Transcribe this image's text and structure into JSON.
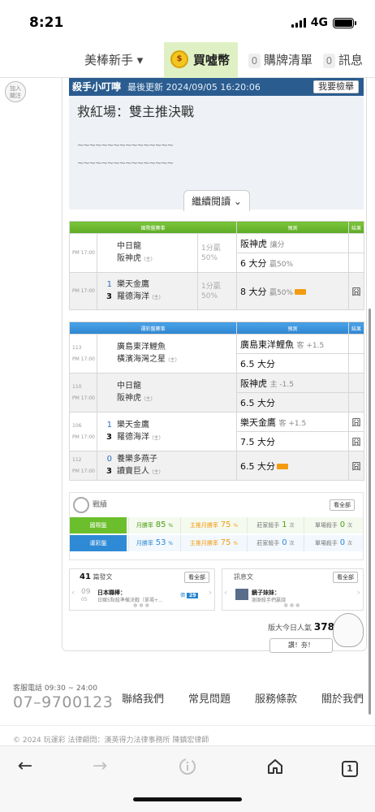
{
  "status": {
    "time": "8:21",
    "network": "4G"
  },
  "nav": {
    "member": "美棒新手 ▾",
    "buy": "買噓幣",
    "cart_count": "0",
    "cart": "購牌清單",
    "msg_count": "0",
    "msg": "訊息"
  },
  "join": "加入\n關注",
  "tips": {
    "title": "殺手小叮嚀",
    "updated": "最後更新 2024/09/05 16:20:06",
    "report": "我要檢舉",
    "headline": "救紅場：雙主推決戰",
    "line1": "~~~~~~~~~~~~~~~~",
    "line2": "~~~~~~~~~~~~~~~~",
    "more": "繼續閱讀 ⌄"
  },
  "intl": {
    "header_event": "國際盤賽事",
    "header_pred": "預測",
    "header_result": "結果",
    "rows": [
      {
        "time": "PM 17:00",
        "home_num": "",
        "home": "中日龍",
        "away_num": "",
        "away": "阪神虎",
        "away_flag": "(主)",
        "odds": "1分贏\n50%",
        "pred1": "阪神虎",
        "pred1_sub": "讓分",
        "pred2": "6 大分",
        "pred2_sub": "贏50%",
        "hot2": false,
        "result1": "",
        "result2": ""
      },
      {
        "time": "PM 17:00",
        "home_num": "1",
        "home": "樂天金鷹",
        "away_num": "3",
        "away": "羅德海洋",
        "away_flag": "(主)",
        "odds": "1分贏\n50%",
        "pred1": "8 大分",
        "pred1_sub": "贏50%",
        "hot1": true,
        "result1": "囧"
      }
    ]
  },
  "sport": {
    "header_event": "運彩盤賽事",
    "header_pred": "預測",
    "header_result": "結果",
    "rows": [
      {
        "code": "113",
        "time": "PM 17:00",
        "home_num": "",
        "home": "廣島東洋鯉魚",
        "away_num": "",
        "away": "橫濱海灣之星",
        "away_flag": "(主)",
        "pred1": "廣島東洋鯉魚",
        "pred1_sub": "客 +1.5",
        "pred2": "6.5 大分",
        "result1": "",
        "result2": ""
      },
      {
        "code": "110",
        "time": "PM 17:00",
        "home_num": "",
        "home": "中日龍",
        "away_num": "",
        "away": "阪神虎",
        "away_flag": "(主)",
        "pred1": "阪神虎",
        "pred1_sub": "主 -1.5",
        "pred2": "6.5 大分",
        "result1": "",
        "result2": ""
      },
      {
        "code": "106",
        "time": "PM 17:00",
        "home_num": "1",
        "home": "樂天金鷹",
        "away_num": "3",
        "away": "羅德海洋",
        "away_flag": "(主)",
        "pred1": "樂天金鷹",
        "pred1_sub": "客 +1.5",
        "pred2": "7.5 大分",
        "result1": "囧",
        "result2": "囧"
      },
      {
        "code": "112",
        "time": "PM 17:00",
        "home_num": "0",
        "home": "養樂多燕子",
        "away_num": "3",
        "away": "讀賣巨人",
        "away_flag": "(主)",
        "pred1": "6.5 大分",
        "hot1": true,
        "result1": "囧"
      }
    ]
  },
  "stats": {
    "title": "戰績",
    "see_all": "看全部",
    "intl": {
      "label": "國際盤",
      "month_rate": "月勝率",
      "month_val": "85",
      "main_rate": "主推月勝率",
      "main_val": "75",
      "banker": "莊家殺手",
      "banker_val": "1",
      "single": "單場殺手",
      "single_val": "0",
      "unit_pct": "%",
      "unit_times": "次"
    },
    "sport": {
      "label": "運彩盤",
      "month_rate": "月勝率",
      "month_val": "53",
      "main_rate": "主推月勝率",
      "main_val": "75",
      "banker": "莊家殺手",
      "banker_val": "0",
      "single": "單場殺手",
      "single_val": "0",
      "unit_pct": "%",
      "unit_times": "次"
    },
    "colors": {
      "intl": "#6cbf2c",
      "sport": "#2f8ad6",
      "main": "#f39c12"
    }
  },
  "posts": {
    "count": "41",
    "count_label": "篇發文",
    "see_all": "看全部",
    "date_m": "09",
    "date_d": "05",
    "title": "日本職棒：",
    "excerpt": "日職5點殺準備決戰（單場+…",
    "price_label": "價",
    "price": "29"
  },
  "followers": {
    "title": "訊息文",
    "see_all": "看全部",
    "name": "鏡子妹妹：",
    "excerpt": "謝謝殺手們贏錢"
  },
  "popularity": {
    "label": "版大今日人氣",
    "value": "3783",
    "bubble": "讚！夯！"
  },
  "footer": {
    "hotline_label": "客服電話 09:30 ~ 24:00",
    "hotline": "07–9700123",
    "links": [
      "聯絡我們",
      "常見問題",
      "服務條款",
      "關於我們"
    ],
    "copyright": "© 2024 玩運彩 法律顧問：漢英得力法律事務所 陳鎮宏律師"
  },
  "browser": {
    "back": "←",
    "forward": "→",
    "tabs": "1"
  }
}
